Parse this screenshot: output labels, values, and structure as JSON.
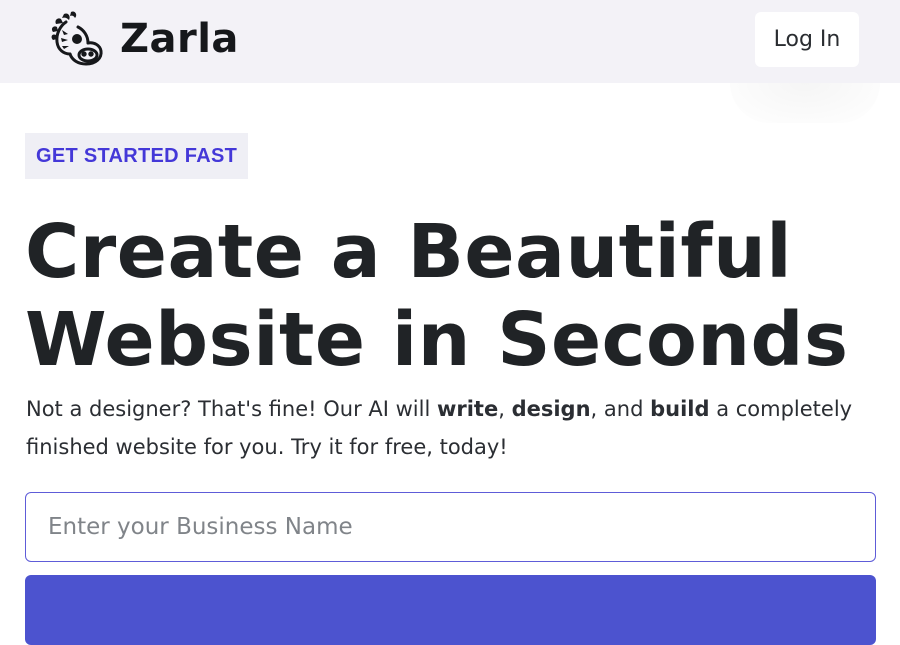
{
  "header": {
    "brand_name": "Zarla",
    "logo_icon": "zebra-head-icon",
    "login_label": "Log In"
  },
  "hero": {
    "eyebrow": "GET STARTED FAST",
    "headline_line1": "Create a Beautiful",
    "headline_line2": "Website in Seconds",
    "subtext": {
      "part1": "Not a designer? That's fine! Our AI will ",
      "bold1": "write",
      "part2": ", ",
      "bold2": "design",
      "part3": ", and ",
      "bold3": "build",
      "part4": " a completely finished website for you. Try it for free, today!"
    },
    "business_input": {
      "placeholder": "Enter your Business Name",
      "value": ""
    }
  },
  "colors": {
    "header_bg": "#f3f2f7",
    "accent": "#4438d8",
    "cta": "#4c53cf",
    "input_border": "#5e5cd8"
  }
}
